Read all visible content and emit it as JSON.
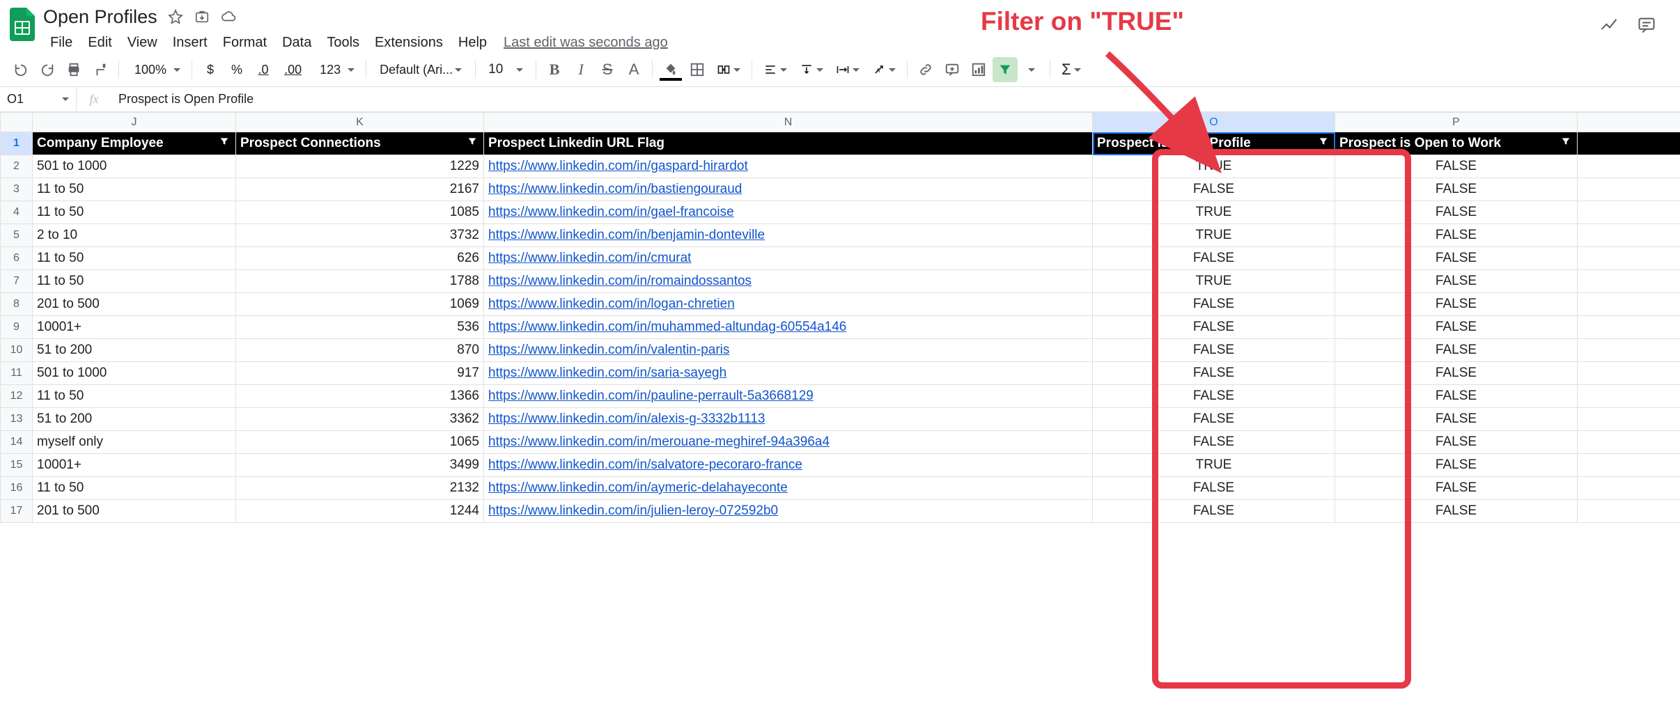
{
  "doc_title": "Open Profiles",
  "menu": {
    "file": "File",
    "edit": "Edit",
    "view": "View",
    "insert": "Insert",
    "format": "Format",
    "data": "Data",
    "tools": "Tools",
    "extensions": "Extensions",
    "help": "Help"
  },
  "last_edit": "Last edit was seconds ago",
  "toolbar": {
    "zoom": "100%",
    "font": "Default (Ari...",
    "size": "10",
    "dollar": "$",
    "percent": "%",
    "dec_dec": ".0",
    "dec_inc": ".00",
    "num_fmt": "123"
  },
  "name_box": "O1",
  "formula": "Prospect is Open Profile",
  "col_letters": [
    "J",
    "K",
    "N",
    "O",
    "P"
  ],
  "selected_col": "O",
  "headers": {
    "j": "Company Employee",
    "k": "Prospect Connections",
    "n": "Prospect Linkedin URL Flag",
    "o": "Prospect is Open Profile",
    "p": "Prospect is Open to Work"
  },
  "rows": [
    {
      "n": 2,
      "j": "501 to 1000",
      "k": 1229,
      "url": "https://www.linkedin.com/in/gaspard-hirardot",
      "o": "TRUE",
      "p": "FALSE"
    },
    {
      "n": 3,
      "j": "11 to 50",
      "k": 2167,
      "url": "https://www.linkedin.com/in/bastiengouraud",
      "o": "FALSE",
      "p": "FALSE"
    },
    {
      "n": 4,
      "j": "11 to 50",
      "k": 1085,
      "url": "https://www.linkedin.com/in/gael-francoise",
      "o": "TRUE",
      "p": "FALSE"
    },
    {
      "n": 5,
      "j": "2 to 10",
      "k": 3732,
      "url": "https://www.linkedin.com/in/benjamin-donteville",
      "o": "TRUE",
      "p": "FALSE"
    },
    {
      "n": 6,
      "j": "11 to 50",
      "k": 626,
      "url": "https://www.linkedin.com/in/cmurat",
      "o": "FALSE",
      "p": "FALSE"
    },
    {
      "n": 7,
      "j": "11 to 50",
      "k": 1788,
      "url": "https://www.linkedin.com/in/romaindossantos",
      "o": "TRUE",
      "p": "FALSE"
    },
    {
      "n": 8,
      "j": "201 to 500",
      "k": 1069,
      "url": "https://www.linkedin.com/in/logan-chretien",
      "o": "FALSE",
      "p": "FALSE"
    },
    {
      "n": 9,
      "j": "10001+",
      "k": 536,
      "url": "https://www.linkedin.com/in/muhammed-altundag-60554a146",
      "o": "FALSE",
      "p": "FALSE"
    },
    {
      "n": 10,
      "j": "51 to 200",
      "k": 870,
      "url": "https://www.linkedin.com/in/valentin-paris",
      "o": "FALSE",
      "p": "FALSE"
    },
    {
      "n": 11,
      "j": "501 to 1000",
      "k": 917,
      "url": "https://www.linkedin.com/in/saria-sayegh",
      "o": "FALSE",
      "p": "FALSE"
    },
    {
      "n": 12,
      "j": "11 to 50",
      "k": 1366,
      "url": "https://www.linkedin.com/in/pauline-perrault-5a3668129",
      "o": "FALSE",
      "p": "FALSE"
    },
    {
      "n": 13,
      "j": "51 to 200",
      "k": 3362,
      "url": "https://www.linkedin.com/in/alexis-g-3332b1113",
      "o": "FALSE",
      "p": "FALSE"
    },
    {
      "n": 14,
      "j": "myself only",
      "k": 1065,
      "url": "https://www.linkedin.com/in/merouane-meghiref-94a396a4",
      "o": "FALSE",
      "p": "FALSE"
    },
    {
      "n": 15,
      "j": "10001+",
      "k": 3499,
      "url": "https://www.linkedin.com/in/salvatore-pecoraro-france",
      "o": "TRUE",
      "p": "FALSE"
    },
    {
      "n": 16,
      "j": "11 to 50",
      "k": 2132,
      "url": "https://www.linkedin.com/in/aymeric-delahayeconte",
      "o": "FALSE",
      "p": "FALSE"
    },
    {
      "n": 17,
      "j": "201 to 500",
      "k": 1244,
      "url": "https://www.linkedin.com/in/julien-leroy-072592b0",
      "o": "FALSE",
      "p": "FALSE"
    }
  ],
  "annotation": "Filter on \"TRUE\""
}
